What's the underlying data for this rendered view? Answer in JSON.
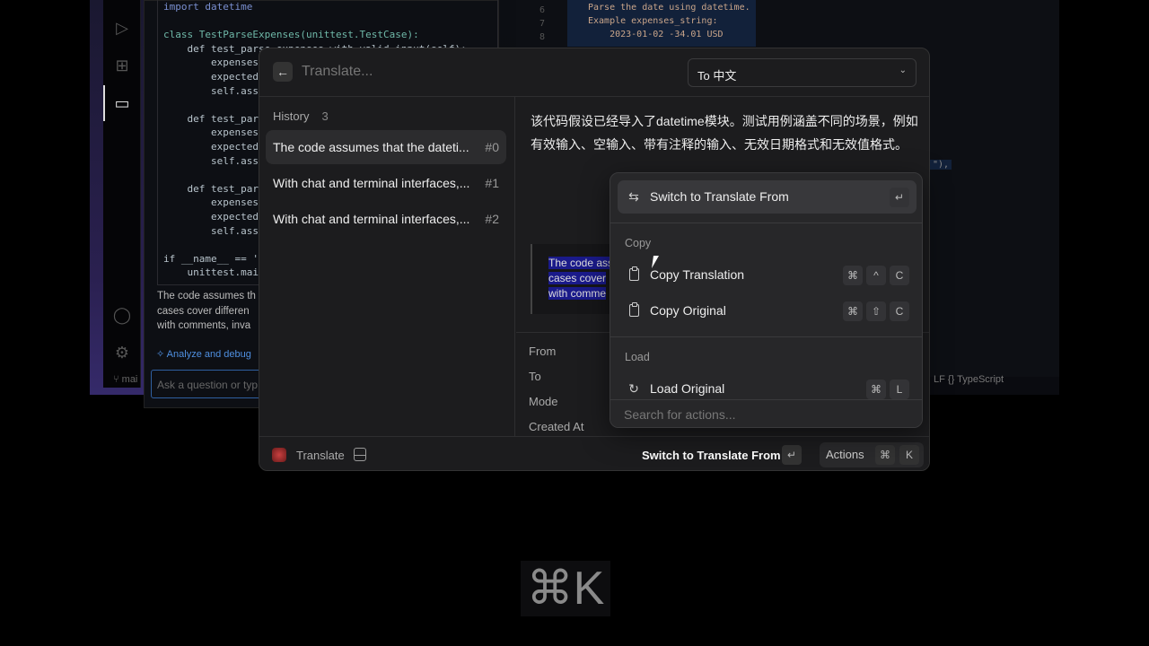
{
  "background_editor": {
    "code_lines": [
      "import datetime",
      "",
      "class TestParseExpenses(unittest.TestCase):",
      "    def test_parse_expenses_with_valid_input(self):",
      "        expenses_",
      "        expected_",
      "        self.asse",
      "",
      "    def test_pars",
      "        expenses_",
      "        expected_",
      "        self.asse",
      "",
      "    def test_pars",
      "        expenses_",
      "        expected_",
      "        self.asse",
      "",
      "if __name__ == '",
      "    unittest.mai"
    ],
    "chat_text": [
      "The code assumes th",
      "cases cover differen",
      "with comments, inva"
    ],
    "analyze_link": "Analyze and debug",
    "ask_placeholder": "Ask a question or typ",
    "branch": "mai",
    "right_line_numbers": [
      "6",
      "7",
      "8"
    ],
    "right_code_lines": [
      "Parse the date using datetime.",
      "Example expenses_string:",
      "    2023-01-02 -34.01 USD"
    ],
    "right_fragment": "\"),",
    "status_bar": "LF   {} TypeScript"
  },
  "modal": {
    "search_placeholder": "Translate...",
    "language_dropdown": "To 中文",
    "history": {
      "label": "History",
      "count": "3",
      "items": [
        {
          "text": "The code assumes that the dateti...",
          "num": "#0",
          "selected": true
        },
        {
          "text": "With chat and terminal interfaces,...",
          "num": "#1"
        },
        {
          "text": "With chat and terminal interfaces,...",
          "num": "#2"
        }
      ]
    },
    "translation": "该代码假设已经导入了datetime模块。测试用例涵盖不同的场景，例如有效输入、空输入、带有注释的输入、无效日期格式和无效值格式。",
    "original_quote": [
      "The code ass",
      "cases cover",
      "with comme"
    ],
    "metadata_labels": [
      "From",
      "To",
      "Mode",
      "Created At"
    ],
    "footer": {
      "app_name": "Translate",
      "primary_action": "Switch to Translate From",
      "primary_key": "↵",
      "actions_label": "Actions",
      "actions_keys": [
        "⌘",
        "K"
      ]
    }
  },
  "actions_popover": {
    "primary": {
      "label": "Switch to Translate From",
      "icon": "swap-icon",
      "keys": [
        "↵"
      ]
    },
    "sections": [
      {
        "title": "Copy",
        "items": [
          {
            "label": "Copy Translation",
            "icon": "clipboard-icon",
            "keys": [
              "⌘",
              "^",
              "C"
            ]
          },
          {
            "label": "Copy Original",
            "icon": "clipboard-icon",
            "keys": [
              "⌘",
              "⇧",
              "C"
            ]
          }
        ]
      },
      {
        "title": "Load",
        "items": [
          {
            "label": "Load Original",
            "icon": "reload-icon",
            "keys": [
              "⌘",
              "L"
            ]
          }
        ]
      }
    ],
    "search_placeholder": "Search for actions..."
  },
  "overlay_shortcut": "⌘K"
}
